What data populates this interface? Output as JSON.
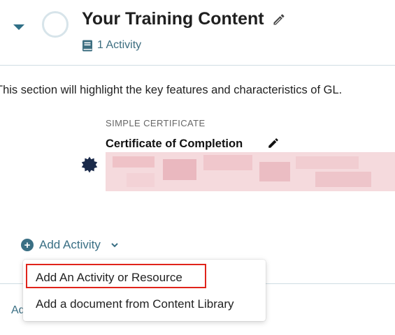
{
  "section": {
    "title": "Your Training Content",
    "activity_count": "1 Activity",
    "description": "This section will highlight the key features and characteristics of GL."
  },
  "certificate": {
    "type_label": "SIMPLE CERTIFICATE",
    "name": "Certificate of Completion"
  },
  "add_activity": {
    "label": "Add Activity"
  },
  "dropdown": {
    "items": [
      "Add An Activity or Resource",
      "Add a document from Content Library"
    ],
    "highlighted_index": 0
  },
  "partial_link": "Ad",
  "icons": {
    "collapse": "chevron-down-icon",
    "progress": "progress-circle-icon",
    "edit": "pencil-icon",
    "book": "book-icon",
    "badge": "badge-icon",
    "add": "plus-circle-icon"
  },
  "colors": {
    "accent": "#3a6f84",
    "highlight": "#e0241b",
    "progress_ring": "#d7e4ea",
    "redaction": "#f2cbcf",
    "badge": "#1b2a4a"
  }
}
